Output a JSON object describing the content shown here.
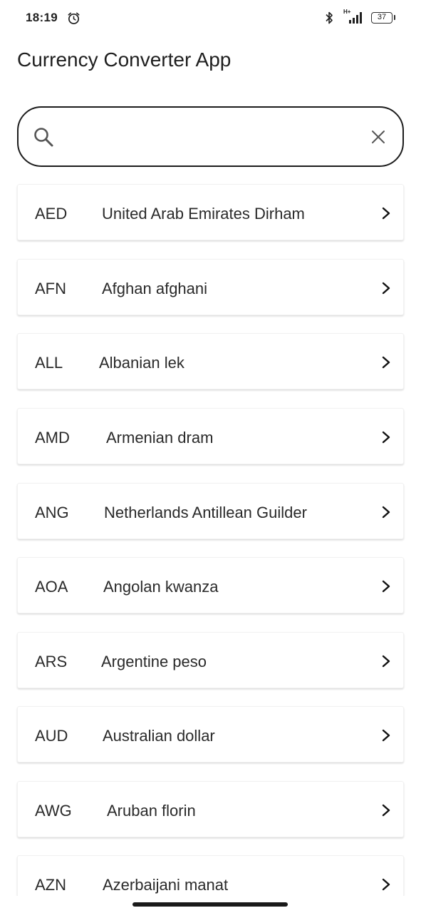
{
  "status_bar": {
    "time": "18:19",
    "network": "H+",
    "battery": "37"
  },
  "header": {
    "title": "Currency Converter App"
  },
  "search": {
    "value": "",
    "placeholder": ""
  },
  "currencies": [
    {
      "code": "AED",
      "name": "United Arab Emirates Dirham"
    },
    {
      "code": "AFN",
      "name": "Afghan afghani"
    },
    {
      "code": "ALL",
      "name": "Albanian lek"
    },
    {
      "code": "AMD",
      "name": "Armenian dram"
    },
    {
      "code": "ANG",
      "name": "Netherlands Antillean Guilder"
    },
    {
      "code": "AOA",
      "name": "Angolan kwanza"
    },
    {
      "code": "ARS",
      "name": "Argentine peso"
    },
    {
      "code": "AUD",
      "name": "Australian dollar"
    },
    {
      "code": "AWG",
      "name": "Aruban florin"
    },
    {
      "code": "AZN",
      "name": "Azerbaijani manat"
    }
  ],
  "colors": {
    "text": "#1f1f1f",
    "border": "#1c1c1c",
    "background": "#ffffff"
  }
}
